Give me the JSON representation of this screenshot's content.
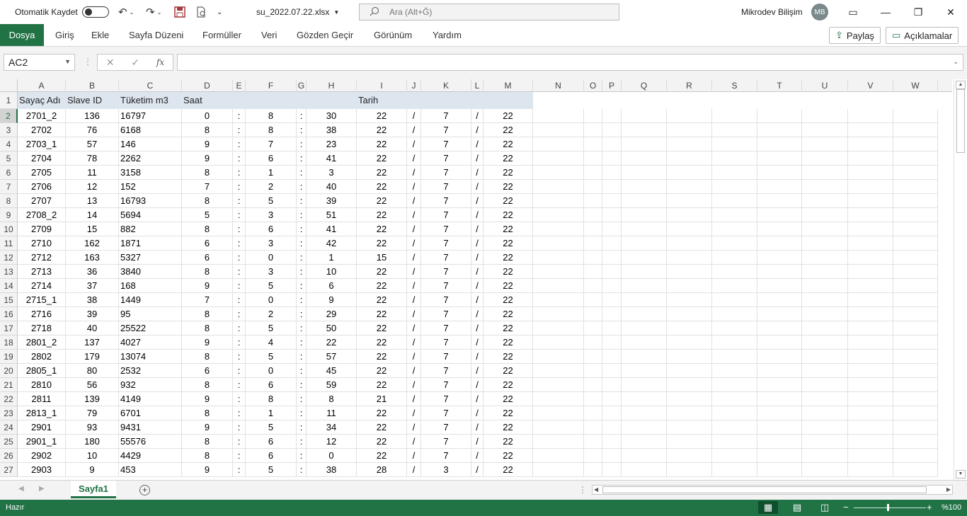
{
  "title_bar": {
    "autosave_label": "Otomatik Kaydet",
    "filename": "su_2022.07.22.xlsx",
    "search_placeholder": "Ara (Alt+Ğ)",
    "user_name": "Mikrodev Bilişim",
    "user_initials": "MB"
  },
  "ribbon": {
    "tabs": [
      "Dosya",
      "Giriş",
      "Ekle",
      "Sayfa Düzeni",
      "Formüller",
      "Veri",
      "Gözden Geçir",
      "Görünüm",
      "Yardım"
    ],
    "share_label": "Paylaş",
    "comments_label": "Açıklamalar"
  },
  "formula_bar": {
    "name_box": "AC2",
    "fx_label": "fx",
    "formula": ""
  },
  "columns": [
    "A",
    "B",
    "C",
    "D",
    "E",
    "F",
    "G",
    "H",
    "I",
    "J",
    "K",
    "L",
    "M",
    "N",
    "O",
    "P",
    "Q",
    "R",
    "S",
    "T",
    "U",
    "V",
    "W"
  ],
  "header_row": {
    "row_number": "1",
    "a": "Sayaç Adı",
    "b": "Slave ID",
    "c": "Tüketim m3",
    "d": "Saat",
    "i": "Tarih"
  },
  "rows": [
    {
      "n": "2",
      "a": "2701_2",
      "b": "136",
      "c": "16797",
      "d": "0",
      "e": ":",
      "f": "8",
      "g": ":",
      "h": "30",
      "i": "22",
      "j": "/",
      "k": "7",
      "l": "/",
      "m": "22"
    },
    {
      "n": "3",
      "a": "2702",
      "b": "76",
      "c": "6168",
      "d": "8",
      "e": ":",
      "f": "8",
      "g": ":",
      "h": "38",
      "i": "22",
      "j": "/",
      "k": "7",
      "l": "/",
      "m": "22"
    },
    {
      "n": "4",
      "a": "2703_1",
      "b": "57",
      "c": "146",
      "d": "9",
      "e": ":",
      "f": "7",
      "g": ":",
      "h": "23",
      "i": "22",
      "j": "/",
      "k": "7",
      "l": "/",
      "m": "22"
    },
    {
      "n": "5",
      "a": "2704",
      "b": "78",
      "c": "2262",
      "d": "9",
      "e": ":",
      "f": "6",
      "g": ":",
      "h": "41",
      "i": "22",
      "j": "/",
      "k": "7",
      "l": "/",
      "m": "22"
    },
    {
      "n": "6",
      "a": "2705",
      "b": "11",
      "c": "3158",
      "d": "8",
      "e": ":",
      "f": "1",
      "g": ":",
      "h": "3",
      "i": "22",
      "j": "/",
      "k": "7",
      "l": "/",
      "m": "22"
    },
    {
      "n": "7",
      "a": "2706",
      "b": "12",
      "c": "152",
      "d": "7",
      "e": ":",
      "f": "2",
      "g": ":",
      "h": "40",
      "i": "22",
      "j": "/",
      "k": "7",
      "l": "/",
      "m": "22"
    },
    {
      "n": "8",
      "a": "2707",
      "b": "13",
      "c": "16793",
      "d": "8",
      "e": ":",
      "f": "5",
      "g": ":",
      "h": "39",
      "i": "22",
      "j": "/",
      "k": "7",
      "l": "/",
      "m": "22"
    },
    {
      "n": "9",
      "a": "2708_2",
      "b": "14",
      "c": "5694",
      "d": "5",
      "e": ":",
      "f": "3",
      "g": ":",
      "h": "51",
      "i": "22",
      "j": "/",
      "k": "7",
      "l": "/",
      "m": "22"
    },
    {
      "n": "10",
      "a": "2709",
      "b": "15",
      "c": "882",
      "d": "8",
      "e": ":",
      "f": "6",
      "g": ":",
      "h": "41",
      "i": "22",
      "j": "/",
      "k": "7",
      "l": "/",
      "m": "22"
    },
    {
      "n": "11",
      "a": "2710",
      "b": "162",
      "c": "1871",
      "d": "6",
      "e": ":",
      "f": "3",
      "g": ":",
      "h": "42",
      "i": "22",
      "j": "/",
      "k": "7",
      "l": "/",
      "m": "22"
    },
    {
      "n": "12",
      "a": "2712",
      "b": "163",
      "c": "5327",
      "d": "6",
      "e": ":",
      "f": "0",
      "g": ":",
      "h": "1",
      "i": "15",
      "j": "/",
      "k": "7",
      "l": "/",
      "m": "22"
    },
    {
      "n": "13",
      "a": "2713",
      "b": "36",
      "c": "3840",
      "d": "8",
      "e": ":",
      "f": "3",
      "g": ":",
      "h": "10",
      "i": "22",
      "j": "/",
      "k": "7",
      "l": "/",
      "m": "22"
    },
    {
      "n": "14",
      "a": "2714",
      "b": "37",
      "c": "168",
      "d": "9",
      "e": ":",
      "f": "5",
      "g": ":",
      "h": "6",
      "i": "22",
      "j": "/",
      "k": "7",
      "l": "/",
      "m": "22"
    },
    {
      "n": "15",
      "a": "2715_1",
      "b": "38",
      "c": "1449",
      "d": "7",
      "e": ":",
      "f": "0",
      "g": ":",
      "h": "9",
      "i": "22",
      "j": "/",
      "k": "7",
      "l": "/",
      "m": "22"
    },
    {
      "n": "16",
      "a": "2716",
      "b": "39",
      "c": "95",
      "d": "8",
      "e": ":",
      "f": "2",
      "g": ":",
      "h": "29",
      "i": "22",
      "j": "/",
      "k": "7",
      "l": "/",
      "m": "22"
    },
    {
      "n": "17",
      "a": "2718",
      "b": "40",
      "c": "25522",
      "d": "8",
      "e": ":",
      "f": "5",
      "g": ":",
      "h": "50",
      "i": "22",
      "j": "/",
      "k": "7",
      "l": "/",
      "m": "22"
    },
    {
      "n": "18",
      "a": "2801_2",
      "b": "137",
      "c": "4027",
      "d": "9",
      "e": ":",
      "f": "4",
      "g": ":",
      "h": "22",
      "i": "22",
      "j": "/",
      "k": "7",
      "l": "/",
      "m": "22"
    },
    {
      "n": "19",
      "a": "2802",
      "b": "179",
      "c": "13074",
      "d": "8",
      "e": ":",
      "f": "5",
      "g": ":",
      "h": "57",
      "i": "22",
      "j": "/",
      "k": "7",
      "l": "/",
      "m": "22"
    },
    {
      "n": "20",
      "a": "2805_1",
      "b": "80",
      "c": "2532",
      "d": "6",
      "e": ":",
      "f": "0",
      "g": ":",
      "h": "45",
      "i": "22",
      "j": "/",
      "k": "7",
      "l": "/",
      "m": "22"
    },
    {
      "n": "21",
      "a": "2810",
      "b": "56",
      "c": "932",
      "d": "8",
      "e": ":",
      "f": "6",
      "g": ":",
      "h": "59",
      "i": "22",
      "j": "/",
      "k": "7",
      "l": "/",
      "m": "22"
    },
    {
      "n": "22",
      "a": "2811",
      "b": "139",
      "c": "4149",
      "d": "9",
      "e": ":",
      "f": "8",
      "g": ":",
      "h": "8",
      "i": "21",
      "j": "/",
      "k": "7",
      "l": "/",
      "m": "22"
    },
    {
      "n": "23",
      "a": "2813_1",
      "b": "79",
      "c": "6701",
      "d": "8",
      "e": ":",
      "f": "1",
      "g": ":",
      "h": "11",
      "i": "22",
      "j": "/",
      "k": "7",
      "l": "/",
      "m": "22"
    },
    {
      "n": "24",
      "a": "2901",
      "b": "93",
      "c": "9431",
      "d": "9",
      "e": ":",
      "f": "5",
      "g": ":",
      "h": "34",
      "i": "22",
      "j": "/",
      "k": "7",
      "l": "/",
      "m": "22"
    },
    {
      "n": "25",
      "a": "2901_1",
      "b": "180",
      "c": "55576",
      "d": "8",
      "e": ":",
      "f": "6",
      "g": ":",
      "h": "12",
      "i": "22",
      "j": "/",
      "k": "7",
      "l": "/",
      "m": "22"
    },
    {
      "n": "26",
      "a": "2902",
      "b": "10",
      "c": "4429",
      "d": "8",
      "e": ":",
      "f": "6",
      "g": ":",
      "h": "0",
      "i": "22",
      "j": "/",
      "k": "7",
      "l": "/",
      "m": "22"
    },
    {
      "n": "27",
      "a": "2903",
      "b": "9",
      "c": "453",
      "d": "9",
      "e": ":",
      "f": "5",
      "g": ":",
      "h": "38",
      "i": "28",
      "j": "/",
      "k": "3",
      "l": "/",
      "m": "22"
    }
  ],
  "sheet_tabs": [
    "Sayfa1"
  ],
  "status_bar": {
    "ready": "Hazır",
    "zoom": "%100"
  },
  "colors": {
    "accent": "#217346",
    "header_fill": "#dde6ef"
  }
}
